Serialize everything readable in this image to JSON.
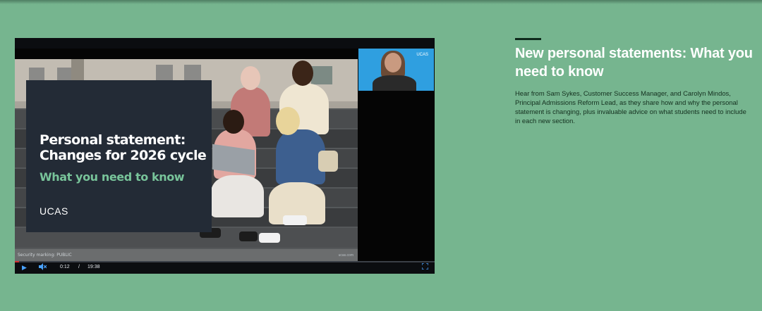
{
  "video": {
    "title_card": {
      "title": "Personal statement: Changes for 2026 cycle",
      "subtitle": "What you need to know",
      "logo": "UCAS"
    },
    "webcam_logo": "UCAS",
    "security_marking": "Security marking: PUBLIC",
    "photo_credit": "ucas.com",
    "controls": {
      "play_icon": "play-icon",
      "mute_icon": "volume-muted-icon",
      "current_time": "0:12",
      "separator": "/",
      "duration": "19:38",
      "fullscreen_icon": "fullscreen-icon",
      "progress": 0.01
    }
  },
  "article": {
    "heading": "New personal statements: What you need to know",
    "body": "Hear from Sam Sykes, Customer Success Manager, and Carolyn Mindos, Principal Admissions Reform Lead, as they share how and why the personal statement is changing, plus invaluable advice on what students need to include in each new section."
  },
  "colors": {
    "page_background": "#76b58f",
    "card_background": "#232b36",
    "accent_green": "#78c49a",
    "control_blue": "#4aa3ff",
    "progress_red": "#d32f2f"
  }
}
